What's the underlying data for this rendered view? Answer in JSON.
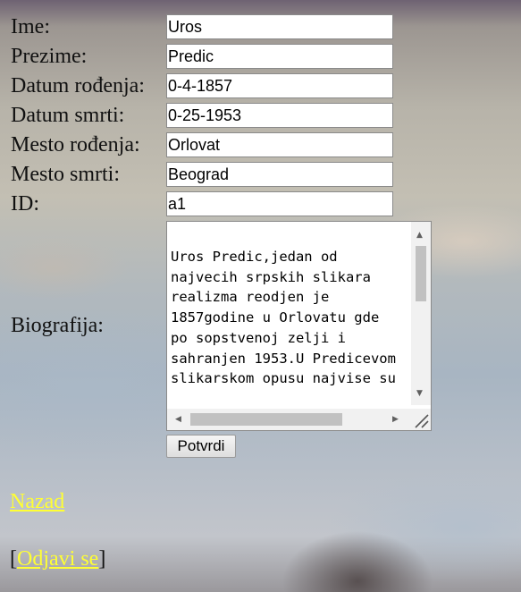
{
  "form": {
    "fields": [
      {
        "label": "Ime:",
        "value": "Uros"
      },
      {
        "label": "Prezime:",
        "value": "Predic"
      },
      {
        "label": "Datum rođenja:",
        "value": "0-4-1857"
      },
      {
        "label": "Datum smrti:",
        "value": "0-25-1953"
      },
      {
        "label": "Mesto rođenja:",
        "value": "Orlovat"
      },
      {
        "label": "Mesto smrti:",
        "value": "Beograd"
      },
      {
        "label": "ID:",
        "value": "a1"
      }
    ],
    "biography_label": "Biografija:",
    "biography_text": "Uros Predic,jedan od najvecih srpskih slikara realizma reodjen je 1857godine u Orlovatu gde  po sopstvenoj zelji i sahranjen 1953.U Predicevom slikarskom opusu najvise su",
    "submit_label": "Potvrdi"
  },
  "nav": {
    "back_label": "Nazad",
    "logout_open": "[",
    "logout_label": "Odjavi se",
    "logout_close": "]"
  },
  "colors": {
    "link": "#ffff33"
  }
}
